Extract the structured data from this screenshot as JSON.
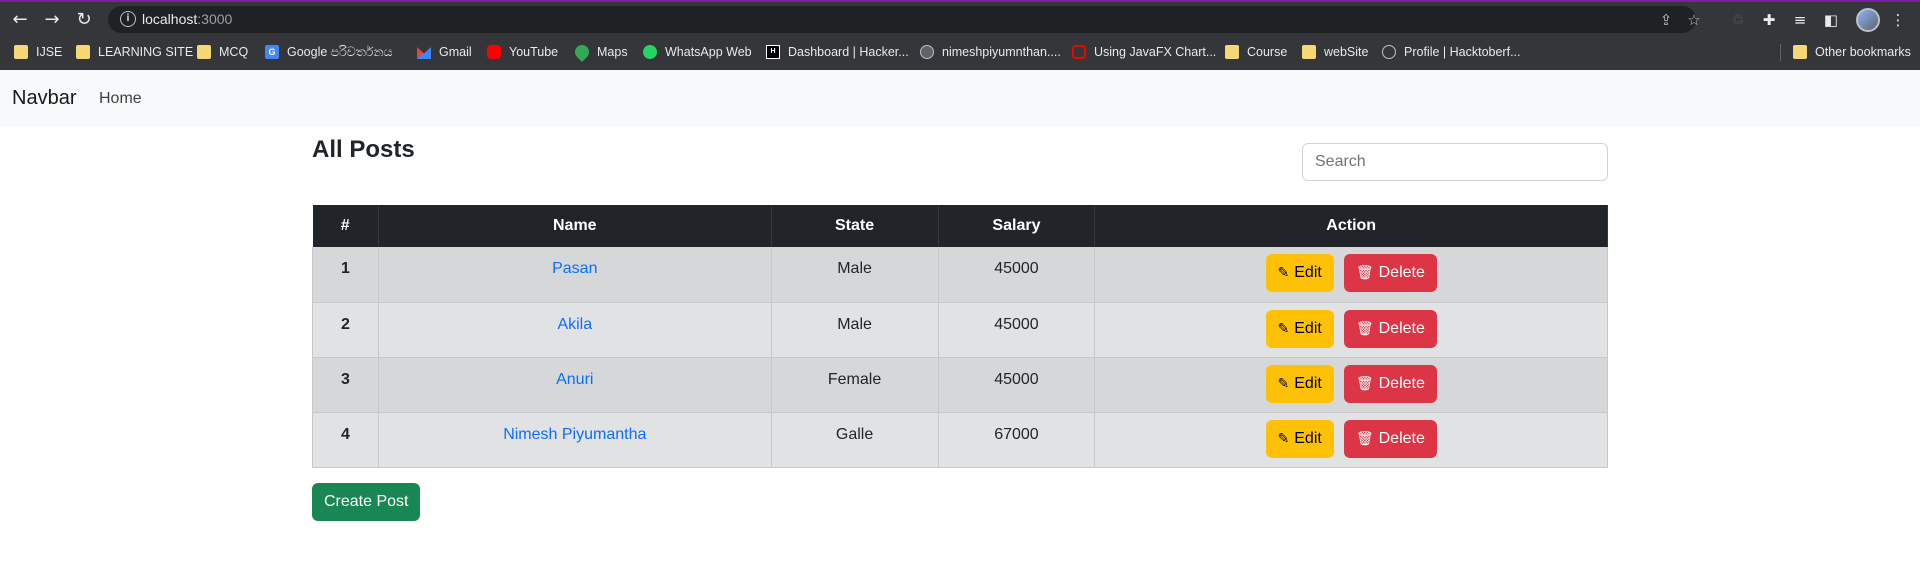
{
  "browser": {
    "url_host": "localhost",
    "url_port": ":3000",
    "bookmarks": [
      {
        "label": "IJSE",
        "icon": "folder-icon"
      },
      {
        "label": "LEARNING SITE",
        "icon": "folder-icon"
      },
      {
        "label": "MCQ",
        "icon": "folder-icon"
      },
      {
        "label": "Google පරිවර්තනය",
        "icon": "google-translate-icon"
      },
      {
        "label": "Gmail",
        "icon": "gmail-icon"
      },
      {
        "label": "YouTube",
        "icon": "youtube-icon"
      },
      {
        "label": "Maps",
        "icon": "maps-icon"
      },
      {
        "label": "WhatsApp Web",
        "icon": "whatsapp-icon"
      },
      {
        "label": "Dashboard | Hacker...",
        "icon": "hackerrank-icon"
      },
      {
        "label": "nimeshpiyumnthan....",
        "icon": "globe-icon"
      },
      {
        "label": "Using JavaFX Chart...",
        "icon": "oracle-icon"
      },
      {
        "label": "Course",
        "icon": "folder-icon"
      },
      {
        "label": "webSite",
        "icon": "folder-icon"
      },
      {
        "label": "Profile | Hacktoberf...",
        "icon": "hacktoberfest-icon"
      }
    ],
    "other_bookmarks": "Other bookmarks"
  },
  "navbar": {
    "brand": "Navbar",
    "home": "Home"
  },
  "main": {
    "title": "All Posts",
    "search_placeholder": "Search",
    "columns": [
      "#",
      "Name",
      "State",
      "Salary",
      "Action"
    ],
    "rows": [
      {
        "index": "1",
        "name": "Pasan",
        "state": "Male",
        "salary": "45000"
      },
      {
        "index": "2",
        "name": "Akila",
        "state": "Male",
        "salary": "45000"
      },
      {
        "index": "3",
        "name": "Anuri",
        "state": "Female",
        "salary": "45000"
      },
      {
        "index": "4",
        "name": "Nimesh Piyumantha",
        "state": "Galle",
        "salary": "67000"
      }
    ],
    "edit_label": "Edit",
    "delete_label": "Delete",
    "create_label": "Create Post"
  },
  "colors": {
    "primary_link": "#0d6efd",
    "warning": "#ffc107",
    "danger": "#dc3545",
    "success": "#198754",
    "table_head": "#212529"
  }
}
